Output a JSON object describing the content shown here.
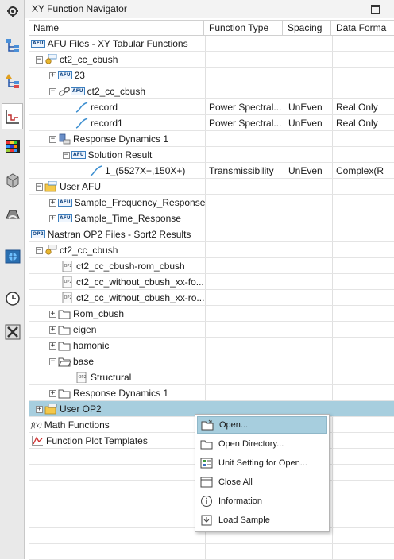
{
  "navigator": {
    "title": "XY Function Navigator"
  },
  "columns": [
    "Name",
    "Function Type",
    "Spacing",
    "Data Forma"
  ],
  "tree": {
    "afu_files": "AFU Files - XY Tabular Functions",
    "ct2_cc_cbush": "ct2_cc_cbush",
    "folder_23": "23",
    "ct2_cc_cbush_child": "ct2_cc_cbush",
    "record": {
      "name": "record",
      "type": "Power Spectral...",
      "spacing": "UnEven",
      "format": "Real Only"
    },
    "record1": {
      "name": "record1",
      "type": "Power Spectral...",
      "spacing": "UnEven",
      "format": "Real Only"
    },
    "response_dynamics": "Response Dynamics 1",
    "solution_result": "Solution Result",
    "transmissibility": {
      "name": "1_(5527X+,150X+)",
      "type": "Transmissibility",
      "spacing": "UnEven",
      "format": "Complex(R"
    },
    "user_afu": "User AFU",
    "sample_freq": "Sample_Frequency_Response",
    "sample_time": "Sample_Time_Response",
    "nastran_op2": "Nastran OP2 Files - Sort2 Results",
    "op2_ct2_cc_cbush": "ct2_cc_cbush",
    "rom_cbush_file": "ct2_cc_cbush-rom_cbush",
    "without_cbush_1": "ct2_cc_without_cbush_xx-fo...",
    "without_cbush_2": "ct2_cc_without_cbush_xx-ro...",
    "rom_cbush_folder": "Rom_cbush",
    "eigen": "eigen",
    "hamonic": "hamonic",
    "base": "base",
    "structural": "Structural",
    "response_dynamics_2": "Response Dynamics 1",
    "user_op2": "User OP2",
    "math_functions": "Math Functions",
    "plot_templates": "Function Plot Templates"
  },
  "context_menu": [
    "Open...",
    "Open Directory...",
    "Unit Setting for Open...",
    "Close All",
    "Information",
    "Load Sample"
  ],
  "tags": {
    "afu": "AFU",
    "op2": "OP2",
    "fx": "f(x)"
  },
  "colors": {
    "selection": "#a7cede",
    "accent": "#3d7fbf"
  }
}
